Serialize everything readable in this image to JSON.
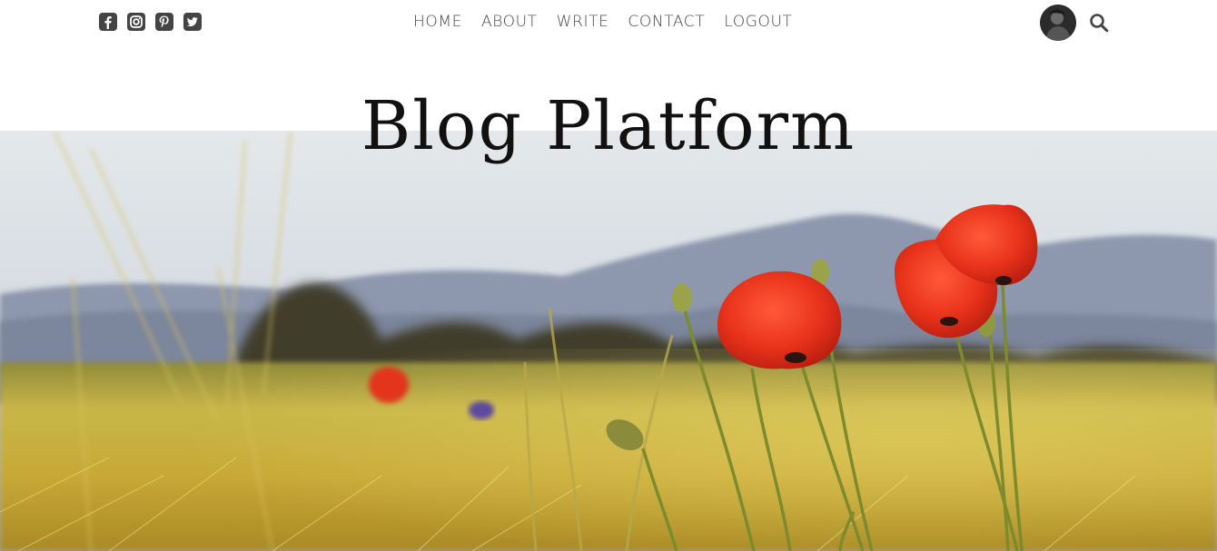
{
  "social": {
    "icons": [
      "facebook-square-icon",
      "instagram-square-icon",
      "pinterest-square-icon",
      "twitter-square-icon"
    ]
  },
  "nav": {
    "items": [
      {
        "label": "HOME"
      },
      {
        "label": "ABOUT"
      },
      {
        "label": "WRITE"
      },
      {
        "label": "CONTACT"
      },
      {
        "label": "LOGOUT"
      }
    ]
  },
  "header": {
    "title": "Blog Platform"
  },
  "colors": {
    "text": "#444444",
    "title": "#111111",
    "poppy": "#e3321c",
    "field": "#c2a934"
  },
  "icons": {
    "search": "search-icon",
    "avatar": "avatar"
  }
}
